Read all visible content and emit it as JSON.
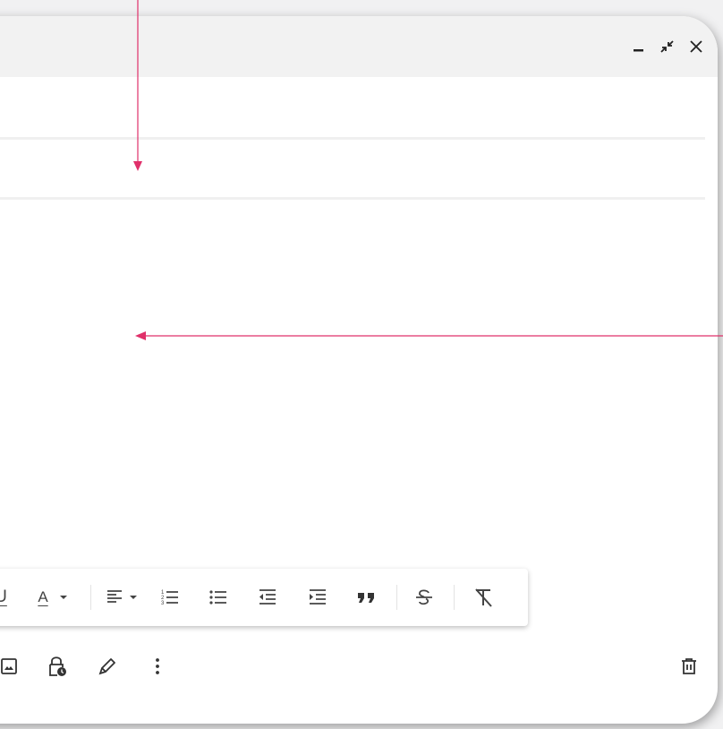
{
  "compose": {
    "titlebar": {
      "controls": [
        {
          "name": "minimize-button",
          "icon": "minimize-icon"
        },
        {
          "name": "exit-fullscreen-button",
          "icon": "exit-fullscreen-icon"
        },
        {
          "name": "close-button",
          "icon": "close-icon"
        }
      ]
    },
    "format_toolbar": {
      "underline_label": "U",
      "text_color_label": "A",
      "items": [
        "underline",
        "text-color",
        "align",
        "numbered-list",
        "bulleted-list",
        "indent-less",
        "indent-more",
        "quote",
        "strikethrough",
        "remove-formatting"
      ]
    },
    "bottom_bar": {
      "items": [
        "insert-photo",
        "confidential-mode",
        "insert-signature",
        "more-options",
        "discard-draft"
      ]
    }
  },
  "annotations": {
    "color": "#e0306a"
  }
}
